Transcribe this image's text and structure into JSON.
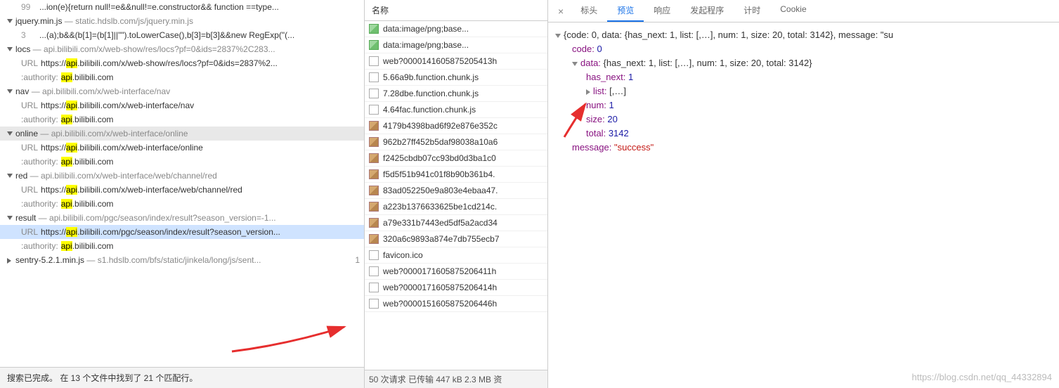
{
  "left": {
    "line99": {
      "num": "99",
      "text": "...ion(e){return null!=e&&null!=e.constructor&& function ==type..."
    },
    "groups": [
      {
        "name": "jquery.min.js",
        "path": "static.hdslb.com/js/jquery.min.js",
        "items": [
          {
            "type": "code",
            "num": "3",
            "text": "...(a);b&&(b[1]=(b[1]||\"\").toLowerCase(),b[3]=b[3]&&new RegExp(\"(..."
          }
        ]
      },
      {
        "name": "locs",
        "path": "api.bilibili.com/x/web-show/res/locs?pf=0&ids=2837%2C283...",
        "items": [
          {
            "type": "url",
            "pre": "https://",
            "hl": "api",
            "post": ".bilibili.com/x/web-show/res/locs?pf=0&ids=2837%2..."
          },
          {
            "type": "auth",
            "hl": "api",
            "post": ".bilibili.com"
          }
        ]
      },
      {
        "name": "nav",
        "path": "api.bilibili.com/x/web-interface/nav",
        "items": [
          {
            "type": "url",
            "pre": "https://",
            "hl": "api",
            "post": ".bilibili.com/x/web-interface/nav"
          },
          {
            "type": "auth",
            "hl": "api",
            "post": ".bilibili.com"
          }
        ]
      },
      {
        "name": "online",
        "path": "api.bilibili.com/x/web-interface/online",
        "selected": true,
        "items": [
          {
            "type": "url",
            "pre": "https://",
            "hl": "api",
            "post": ".bilibili.com/x/web-interface/online"
          },
          {
            "type": "auth",
            "hl": "api",
            "post": ".bilibili.com"
          }
        ]
      },
      {
        "name": "red",
        "path": "api.bilibili.com/x/web-interface/web/channel/red",
        "items": [
          {
            "type": "url",
            "pre": "https://",
            "hl": "api",
            "post": ".bilibili.com/x/web-interface/web/channel/red"
          },
          {
            "type": "auth",
            "hl": "api",
            "post": ".bilibili.com"
          }
        ]
      },
      {
        "name": "result",
        "path": "api.bilibili.com/pgc/season/index/result?season_version=-1...",
        "items": [
          {
            "type": "url",
            "pre": "https://",
            "hl": "api",
            "post": ".bilibili.com/pgc/season/index/result?season_version...",
            "highlighted": true
          },
          {
            "type": "auth",
            "hl": "api",
            "post": ".bilibili.com"
          }
        ]
      },
      {
        "name": "sentry-5.2.1.min.js",
        "path": "s1.hdslb.com/bfs/static/jinkela/long/js/sent...",
        "collapsed": true,
        "count": "1"
      }
    ],
    "footer": "搜索已完成。 在 13 个文件中找到了 21 个匹配行。"
  },
  "mid": {
    "header": "名称",
    "items": [
      {
        "icon": "img",
        "text": "data:image/png;base..."
      },
      {
        "icon": "img",
        "text": "data:image/png;base..."
      },
      {
        "icon": "doc",
        "text": "web?0000141605875205413h"
      },
      {
        "icon": "doc",
        "text": "5.66a9b.function.chunk.js"
      },
      {
        "icon": "doc",
        "text": "7.28dbe.function.chunk.js"
      },
      {
        "icon": "doc",
        "text": "4.64fac.function.chunk.js"
      },
      {
        "icon": "jpg",
        "text": "4179b4398bad6f92e876e352c"
      },
      {
        "icon": "jpg",
        "text": "962b27ff452b5daf98038a10a6"
      },
      {
        "icon": "jpg",
        "text": "f2425cbdb07cc93bd0d3ba1c0"
      },
      {
        "icon": "jpg",
        "text": "f5d5f51b941c01f8b90b361b4."
      },
      {
        "icon": "jpg",
        "text": "83ad052250e9a803e4ebaa47."
      },
      {
        "icon": "jpg",
        "text": "a223b1376633625be1cd214c."
      },
      {
        "icon": "jpg",
        "text": "a79e331b7443ed5df5a2acd34"
      },
      {
        "icon": "jpg",
        "text": "320a6c9893a874e7db755ecb7"
      },
      {
        "icon": "doc",
        "text": "favicon.ico"
      },
      {
        "icon": "doc",
        "text": "web?0000171605875206411h"
      },
      {
        "icon": "doc",
        "text": "web?0000171605875206414h"
      },
      {
        "icon": "doc",
        "text": "web?0000151605875206446h"
      }
    ],
    "footer": "50 次请求  已传输 447 kB  2.3 MB 资"
  },
  "right": {
    "tabs": [
      "标头",
      "预览",
      "响应",
      "发起程序",
      "计时",
      "Cookie"
    ],
    "active_tab": 1,
    "json": {
      "root": "{code: 0, data: {has_next: 1, list: [,…], num: 1, size: 20, total: 3142}, message: \"su",
      "code_k": "code:",
      "code_v": "0",
      "data_k": "data:",
      "data_v": "{has_next: 1, list: [,…], num: 1, size: 20, total: 3142}",
      "hasnext_k": "has_next:",
      "hasnext_v": "1",
      "list_k": "list:",
      "list_v": "[,…]",
      "num_k": "num:",
      "num_v": "1",
      "size_k": "size:",
      "size_v": "20",
      "total_k": "total:",
      "total_v": "3142",
      "msg_k": "message:",
      "msg_v": "\"success\""
    }
  },
  "watermark": "https://blog.csdn.net/qq_44332894"
}
